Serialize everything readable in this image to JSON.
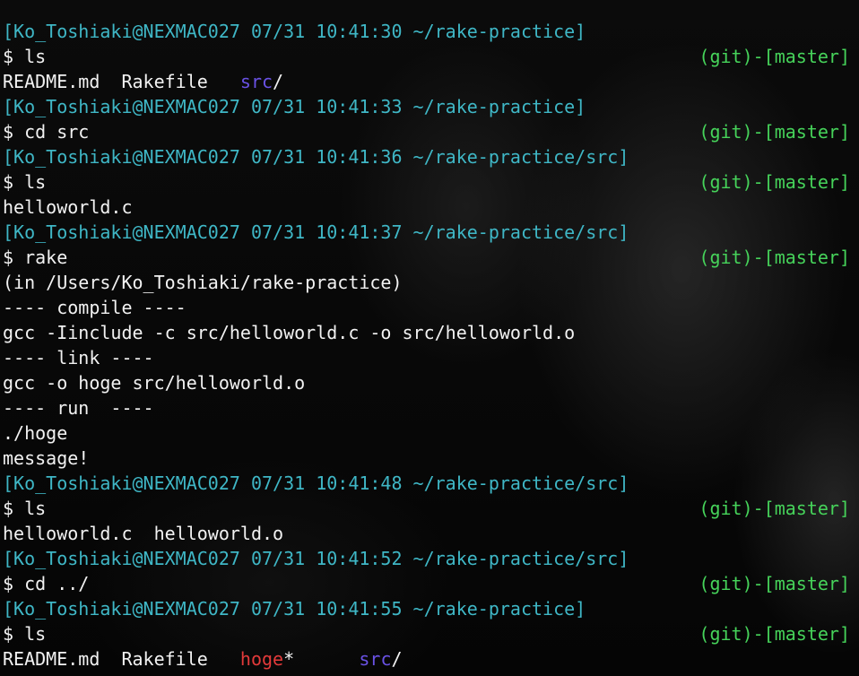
{
  "terminal": {
    "git_tag": "(git)-[master]",
    "lines": [
      {
        "type": "info",
        "text": "[Ko_Toshiaki@NEXMAC027 07/31 10:41:30 ~/rake-practice]"
      },
      {
        "type": "cmd",
        "text": "$ ls"
      },
      {
        "type": "ls1"
      },
      {
        "type": "info",
        "text": "[Ko_Toshiaki@NEXMAC027 07/31 10:41:33 ~/rake-practice]"
      },
      {
        "type": "cmd",
        "text": "$ cd src"
      },
      {
        "type": "info",
        "text": "[Ko_Toshiaki@NEXMAC027 07/31 10:41:36 ~/rake-practice/src]"
      },
      {
        "type": "cmd",
        "text": "$ ls"
      },
      {
        "type": "out",
        "text": "helloworld.c"
      },
      {
        "type": "info",
        "text": "[Ko_Toshiaki@NEXMAC027 07/31 10:41:37 ~/rake-practice/src]"
      },
      {
        "type": "cmd",
        "text": "$ rake"
      },
      {
        "type": "out",
        "text": "(in /Users/Ko_Toshiaki/rake-practice)"
      },
      {
        "type": "out",
        "text": "---- compile ----"
      },
      {
        "type": "out",
        "text": "gcc -Iinclude -c src/helloworld.c -o src/helloworld.o"
      },
      {
        "type": "out",
        "text": "---- link ----"
      },
      {
        "type": "out",
        "text": "gcc -o hoge src/helloworld.o"
      },
      {
        "type": "out",
        "text": "---- run  ----"
      },
      {
        "type": "out",
        "text": "./hoge"
      },
      {
        "type": "out",
        "text": "message!"
      },
      {
        "type": "info",
        "text": "[Ko_Toshiaki@NEXMAC027 07/31 10:41:48 ~/rake-practice/src]"
      },
      {
        "type": "cmd",
        "text": "$ ls"
      },
      {
        "type": "out",
        "text": "helloworld.c  helloworld.o"
      },
      {
        "type": "info",
        "text": "[Ko_Toshiaki@NEXMAC027 07/31 10:41:52 ~/rake-practice/src]"
      },
      {
        "type": "cmd",
        "text": "$ cd ../"
      },
      {
        "type": "info",
        "text": "[Ko_Toshiaki@NEXMAC027 07/31 10:41:55 ~/rake-practice]"
      },
      {
        "type": "cmd",
        "text": "$ ls"
      },
      {
        "type": "ls2"
      }
    ],
    "ls1": {
      "files": "README.md  Rakefile   ",
      "dir": "src",
      "slash": "/"
    },
    "ls2": {
      "files": "README.md  Rakefile   ",
      "exec": "hoge",
      "star": "*",
      "gap": "      ",
      "dir": "src",
      "slash": "/"
    }
  },
  "colors": {
    "prompt_info": "#3fb7c6",
    "git_tag": "#46d35a",
    "directory": "#6a52e6",
    "executable": "#e33a3a",
    "text": "#f2f2f2",
    "background": "#060606"
  }
}
